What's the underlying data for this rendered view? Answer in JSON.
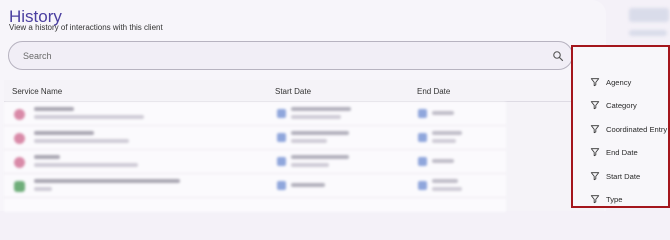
{
  "header": {
    "title": "History",
    "subtitle": "View a history of interactions with this client"
  },
  "search": {
    "placeholder": "Search",
    "icon": "search-icon"
  },
  "filter_button": {
    "icon": "filter-lines-icon"
  },
  "table": {
    "columns": [
      "Service Name",
      "Start Date",
      "End Date"
    ]
  },
  "filter_menu": {
    "items": [
      {
        "label": "Agency",
        "icon": "funnel-icon"
      },
      {
        "label": "Category",
        "icon": "funnel-icon"
      },
      {
        "label": "Coordinated Entry",
        "icon": "funnel-icon"
      },
      {
        "label": "End Date",
        "icon": "funnel-icon"
      },
      {
        "label": "Start Date",
        "icon": "funnel-icon"
      },
      {
        "label": "Type",
        "icon": "funnel-icon"
      }
    ]
  },
  "colors": {
    "title": "#4b3fa0",
    "highlight_border": "#a4161c",
    "accent_icon": "#5b4fc4"
  }
}
